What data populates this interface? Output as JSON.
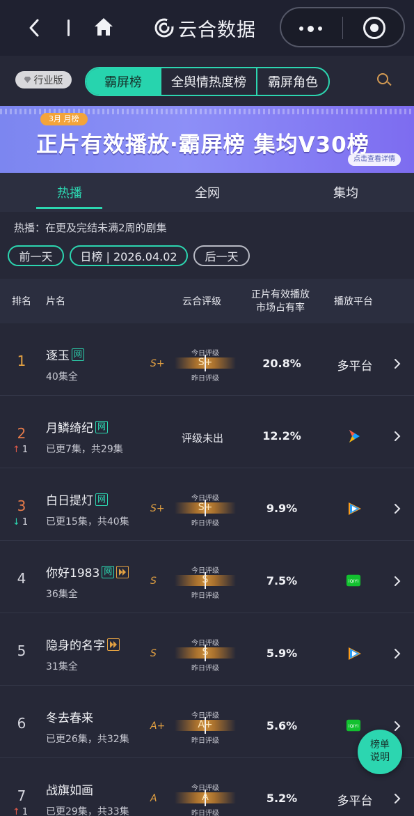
{
  "app": {
    "brand": "云合数据"
  },
  "tabs": {
    "industry_badge": "行业版",
    "items": [
      "霸屏榜",
      "全舆情热度榜",
      "霸屏角色"
    ],
    "active": 0
  },
  "banner": {
    "tag": "3月 月榜",
    "title": "正片有效播放·霸屏榜 集均V30榜",
    "link": "点击查看详情"
  },
  "subtabs": {
    "items": [
      "热播",
      "全网",
      "集均"
    ],
    "active": 0
  },
  "description": "热播：在更及完结未满2周的剧集",
  "date_nav": {
    "prev": "前一天",
    "current": "日榜 | 2026.04.02",
    "next": "后一天"
  },
  "table": {
    "headers": {
      "rank": "排名",
      "title": "片名",
      "rating": "云合评级",
      "share_line1": "正片有效播放",
      "share_line2": "市场占有率",
      "platform": "播放平台"
    },
    "gauge_labels": {
      "today": "今日评级",
      "yesterday": "昨日评级"
    },
    "rows": [
      {
        "rank": "1",
        "title": "逐玉",
        "tags": [
          "网"
        ],
        "sub": "40集全",
        "trend": "",
        "trend_n": "",
        "grade_left": "S+",
        "grade_center": "S+",
        "share": "20.8%",
        "platform": "多平台",
        "platform_icon": ""
      },
      {
        "rank": "2",
        "title": "月鳞绮纪",
        "tags": [
          "网"
        ],
        "sub": "已更7集，共29集",
        "trend": "up",
        "trend_n": "1",
        "grade_left": "",
        "grade_center": "",
        "no_grade": "评级未出",
        "share": "12.2%",
        "platform": "",
        "platform_icon": "youku-icon"
      },
      {
        "rank": "3",
        "title": "白日提灯",
        "tags": [
          "网"
        ],
        "sub": "已更15集，共40集",
        "trend": "down",
        "trend_n": "1",
        "grade_left": "S+",
        "grade_center": "S+",
        "share": "9.9%",
        "platform": "",
        "platform_icon": "tencent-video-icon"
      },
      {
        "rank": "4",
        "title": "你好1983",
        "tags": [
          "网",
          "play"
        ],
        "sub": "36集全",
        "trend": "",
        "trend_n": "",
        "grade_left": "S",
        "grade_center": "S",
        "share": "7.5%",
        "platform": "",
        "platform_icon": "iqiyi-icon"
      },
      {
        "rank": "5",
        "title": "隐身的名字",
        "tags": [
          "play"
        ],
        "sub": "31集全",
        "trend": "",
        "trend_n": "",
        "grade_left": "S",
        "grade_center": "S",
        "share": "5.9%",
        "platform": "",
        "platform_icon": "tencent-video-icon"
      },
      {
        "rank": "6",
        "title": "冬去春来",
        "tags": [],
        "sub": "已更26集，共32集",
        "trend": "",
        "trend_n": "",
        "grade_left": "A+",
        "grade_center": "A+",
        "share": "5.6%",
        "platform": "",
        "platform_icon": "iqiyi-icon"
      },
      {
        "rank": "7",
        "title": "战旗如画",
        "tags": [],
        "sub": "已更29集，共33集",
        "trend": "up",
        "trend_n": "1",
        "grade_left": "A",
        "grade_center": "A",
        "share": "5.2%",
        "platform": "多平台",
        "platform_icon": ""
      }
    ]
  },
  "help_button": {
    "line1": "榜单",
    "line2": "说明"
  },
  "colors": {
    "accent": "#2cd6b0",
    "gold": "#e3a142",
    "bg": "#262837"
  }
}
